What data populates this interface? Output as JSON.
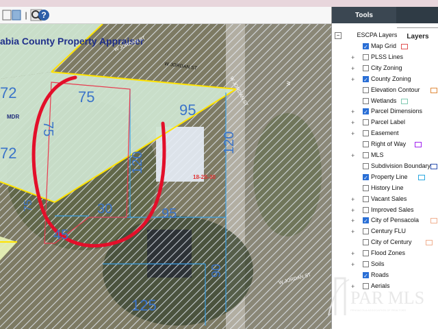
{
  "toolbar": {
    "items": [
      {
        "name": "map-toggle-icon",
        "glyph": "▮▮"
      },
      {
        "name": "separator",
        "glyph": "|"
      },
      {
        "name": "search-map-icon",
        "glyph": "🔍"
      },
      {
        "name": "help-icon",
        "glyph": "?"
      }
    ]
  },
  "map": {
    "header_title": "abia County Property Appraiser",
    "street_1": "W JORDAN ST",
    "street_2": "W JORDAN ST",
    "street_3": "W JORDAN ST",
    "street_4": "W JORDAN ST",
    "street_5": "W",
    "zoning_mdr": "MDR",
    "grid_label": "18-2S-30",
    "dims": [
      "75",
      "95",
      "75",
      "120",
      "120",
      "72",
      "72",
      "45",
      "30",
      "95",
      "125",
      "90",
      "75"
    ]
  },
  "panel": {
    "tabs": {
      "tools": "Tools",
      "layers": "Layers"
    },
    "root_label": "ESCPA Layers",
    "layers": [
      {
        "label": "Map Grid",
        "checked": true,
        "expand": false,
        "swatch": "#e05050"
      },
      {
        "label": "PLSS Lines",
        "checked": false,
        "expand": true
      },
      {
        "label": "City Zoning",
        "checked": false,
        "expand": true
      },
      {
        "label": "County Zoning",
        "checked": true,
        "expand": true
      },
      {
        "label": "Elevation Contour",
        "checked": false,
        "expand": false,
        "swatch": "#e08a3a"
      },
      {
        "label": "Wetlands",
        "checked": false,
        "expand": false,
        "swatch": "#7fc9b0"
      },
      {
        "label": "Parcel Dimensions",
        "checked": true,
        "expand": true
      },
      {
        "label": "Parcel Label",
        "checked": false,
        "expand": true
      },
      {
        "label": "Easement",
        "checked": false,
        "expand": true
      },
      {
        "label": "Right of Way",
        "checked": false,
        "expand": false,
        "swatch": "#a020f0"
      },
      {
        "label": "MLS",
        "checked": false,
        "expand": true
      },
      {
        "label": "Subdivision Boundary",
        "checked": false,
        "expand": false,
        "swatch": "#2a4fb0"
      },
      {
        "label": "Property Line",
        "checked": true,
        "expand": false,
        "swatch": "#2aa8e0"
      },
      {
        "label": "History Line",
        "checked": false,
        "expand": false
      },
      {
        "label": "Vacant Sales",
        "checked": false,
        "expand": true
      },
      {
        "label": "Improved Sales",
        "checked": false,
        "expand": true
      },
      {
        "label": "City of Pensacola",
        "checked": true,
        "expand": true,
        "swatch": "#f0b090"
      },
      {
        "label": "Century FLU",
        "checked": false,
        "expand": true
      },
      {
        "label": "City of Century",
        "checked": false,
        "expand": false,
        "swatch": "#f0b090"
      },
      {
        "label": "Flood Zones",
        "checked": false,
        "expand": true
      },
      {
        "label": "Soils",
        "checked": false,
        "expand": true
      },
      {
        "label": "Roads",
        "checked": true,
        "expand": false
      },
      {
        "label": "Aerials",
        "checked": false,
        "expand": true
      }
    ]
  },
  "watermark": {
    "text": "PAR MLS",
    "subtitle": "PENSACOLA ASSOCIATION OF REALTORS"
  }
}
